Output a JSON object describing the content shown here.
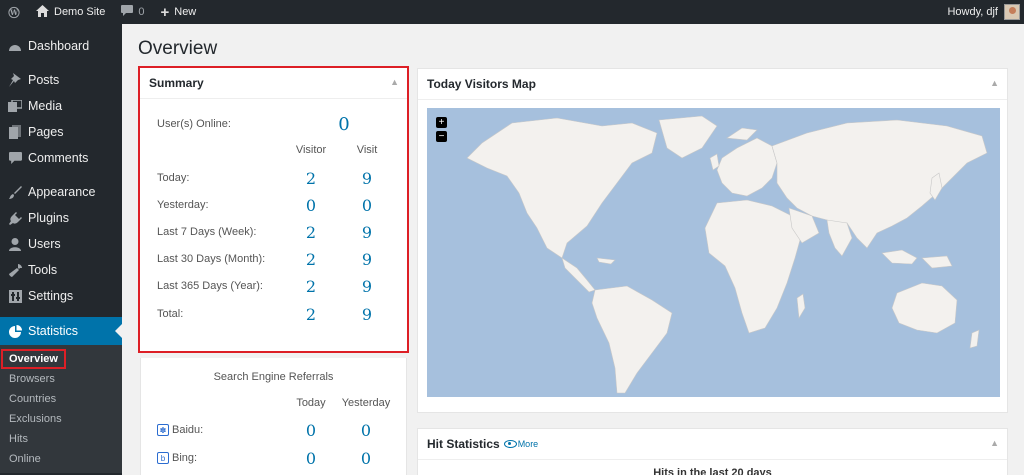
{
  "adminbar": {
    "site_name": "Demo Site",
    "comments_count": "0",
    "new_label": "New",
    "howdy": "Howdy, djf"
  },
  "sidebar": {
    "items": [
      {
        "label": "Dashboard",
        "icon": "dashboard-icon"
      },
      {
        "label": "Posts",
        "icon": "pin-icon"
      },
      {
        "label": "Media",
        "icon": "media-icon"
      },
      {
        "label": "Pages",
        "icon": "pages-icon"
      },
      {
        "label": "Comments",
        "icon": "comment-icon"
      },
      {
        "label": "Appearance",
        "icon": "brush-icon"
      },
      {
        "label": "Plugins",
        "icon": "plug-icon"
      },
      {
        "label": "Users",
        "icon": "user-icon"
      },
      {
        "label": "Tools",
        "icon": "wrench-icon"
      },
      {
        "label": "Settings",
        "icon": "settings-icon"
      },
      {
        "label": "Statistics",
        "icon": "pie-chart-icon"
      }
    ],
    "submenu": [
      "Overview",
      "Browsers",
      "Countries",
      "Exclusions",
      "Hits",
      "Online"
    ]
  },
  "page_title": "Overview",
  "summary": {
    "title": "Summary",
    "online_label": "User(s) Online:",
    "online_value": "0",
    "col_visitor": "Visitor",
    "col_visit": "Visit",
    "rows": [
      {
        "label": "Today:",
        "visitor": "2",
        "visit": "9"
      },
      {
        "label": "Yesterday:",
        "visitor": "0",
        "visit": "0"
      },
      {
        "label": "Last 7 Days (Week):",
        "visitor": "2",
        "visit": "9"
      },
      {
        "label": "Last 30 Days (Month):",
        "visitor": "2",
        "visit": "9"
      },
      {
        "label": "Last 365 Days (Year):",
        "visitor": "2",
        "visit": "9"
      },
      {
        "label": "Total:",
        "visitor": "2",
        "visit": "9"
      }
    ]
  },
  "referrals": {
    "title": "Search Engine Referrals",
    "col_today": "Today",
    "col_yesterday": "Yesterday",
    "rows": [
      {
        "label": "Baidu:",
        "today": "0",
        "yesterday": "0"
      },
      {
        "label": "Bing:",
        "today": "0",
        "yesterday": "0"
      }
    ]
  },
  "map": {
    "title": "Today Visitors Map",
    "zoom_in": "+",
    "zoom_out": "−",
    "ocean_color": "#a6c0dd",
    "land_color": "#f3f1ee"
  },
  "hits": {
    "title": "Hit Statistics",
    "more": "More",
    "subtitle": "Hits in the last 20 days"
  }
}
